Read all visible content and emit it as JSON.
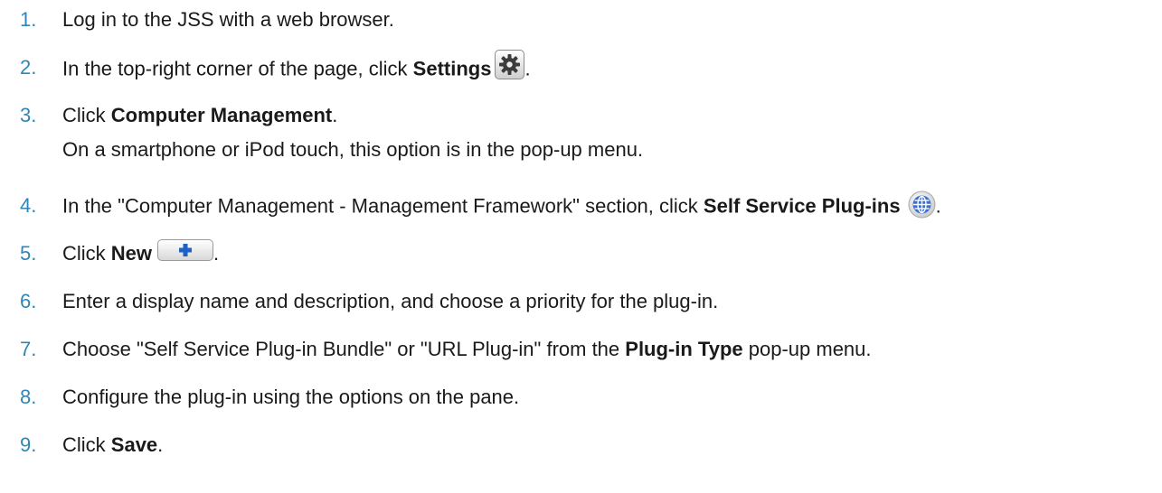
{
  "steps": [
    {
      "num": "1.",
      "text": "Log in to the JSS with a web browser."
    },
    {
      "num": "2.",
      "before": "In the top-right corner of the page, click ",
      "bold": "Settings",
      "icon": "gear-icon",
      "after": "."
    },
    {
      "num": "3.",
      "before": "Click ",
      "bold": "Computer Management",
      "after": ".",
      "sub": "On a smartphone or iPod touch, this option is in the pop-up menu."
    },
    {
      "num": "4.",
      "before": "In the \"Computer Management - Management Framework\" section, click ",
      "bold": "Self Service Plug-ins",
      "icon": "globe-icon",
      "after": "."
    },
    {
      "num": "5.",
      "before": "Click ",
      "bold": "New",
      "icon": "plus-icon",
      "after": "."
    },
    {
      "num": "6.",
      "text": "Enter a display name and description, and choose a priority for the plug-in."
    },
    {
      "num": "7.",
      "before": "Choose \"Self Service Plug-in Bundle\" or \"URL Plug-in\" from the ",
      "bold": "Plug-in Type",
      "after": " pop-up menu."
    },
    {
      "num": "8.",
      "text": "Configure the plug-in using the options on the pane."
    },
    {
      "num": "9.",
      "before": "Click ",
      "bold": "Save",
      "after": "."
    }
  ],
  "colors": {
    "number": "#2f86b6",
    "text": "#1a1a1a",
    "globe": "#3a6fd0"
  }
}
